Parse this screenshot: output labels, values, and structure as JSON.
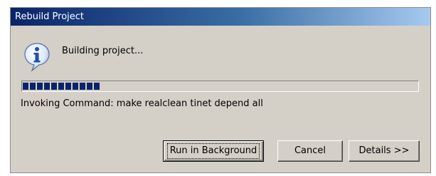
{
  "window": {
    "title": "Rebuild Project"
  },
  "message": {
    "text": "Building project...",
    "icon": "info-icon"
  },
  "progress": {
    "value_fraction": 0.19,
    "color": "#0a246a"
  },
  "status": {
    "text": "Invoking Command: make realclean tinet depend all"
  },
  "buttons": {
    "run_in_background": "Run in Background",
    "cancel": "Cancel",
    "details": "Details >>"
  },
  "colors": {
    "dialog_background": "#d4d0c8",
    "titlebar_start": "#0a246a",
    "titlebar_end": "#a6caf0"
  }
}
